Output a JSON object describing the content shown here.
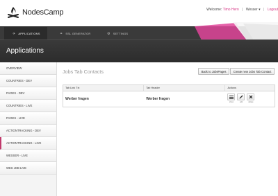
{
  "app": {
    "name": "NodesCamp"
  },
  "userbar": {
    "welcome": "Welcome:",
    "user_name": "Timo Hern",
    "client": "Wesser",
    "logout": "Logout"
  },
  "nav": {
    "tabs": [
      {
        "label": "APPLICATIONS",
        "icon": "rocket-icon",
        "active": true
      },
      {
        "label": "SSL GENERATOR",
        "icon": "link-icon",
        "active": false
      },
      {
        "label": "SETTINGS",
        "icon": "gear-icon",
        "active": false
      }
    ]
  },
  "header": {
    "title": "Applications"
  },
  "sidebar": {
    "items": [
      {
        "label": "OVERVIEW"
      },
      {
        "label": "COUNTRIES - DEV"
      },
      {
        "label": "PAGES - DEV"
      },
      {
        "label": "COUNTRIES - LIVE"
      },
      {
        "label": "PAGES - LIVE"
      },
      {
        "label": "ACTIONTRACKING - DEV"
      },
      {
        "label": "ACTIONTRACKING - LIVE"
      },
      {
        "label": "WESSER - LIVE"
      },
      {
        "label": "WES JOB LIVE"
      }
    ]
  },
  "main": {
    "title": "Jobs Tab Contacts",
    "back_button": "Back to JobsPages",
    "create_button": "Create new Jobs Tab Contact",
    "table": {
      "columns": [
        "Tab Link Txt",
        "Tab Header",
        "Actions"
      ],
      "rows": [
        {
          "link_txt": "Werber fragen",
          "header": "Werber fragen"
        }
      ],
      "action_labels": {
        "show": "show",
        "edit": "edit",
        "delete": "delete"
      }
    }
  },
  "colors": {
    "accent": "#d63384",
    "dark": "#3a3a3a",
    "active_marker": "#c0396b"
  }
}
